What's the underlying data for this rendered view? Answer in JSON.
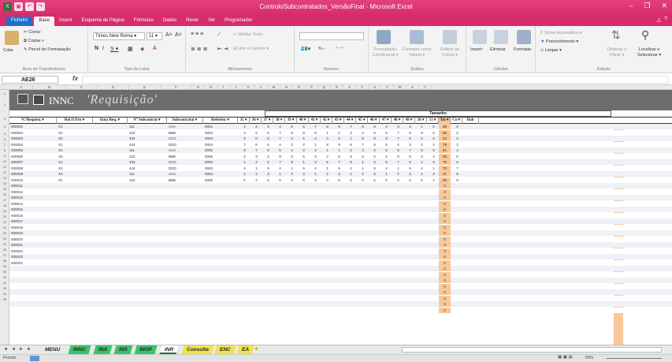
{
  "window": {
    "title": "ControloSubcontratados_VersãoFinal - Microsoft Excel",
    "quick_access": [
      "save-icon",
      "undo-icon",
      "redo-icon"
    ],
    "controls": [
      "–",
      "❐",
      "✕"
    ]
  },
  "ribbon_tabs": [
    "Ficheiro",
    "Base",
    "Inserir",
    "Esquema de Página",
    "Fórmulas",
    "Dados",
    "Rever",
    "Ver",
    "Programador"
  ],
  "ribbon": {
    "clipboard": {
      "cut": "Cortar",
      "copy": "Copiar ▾",
      "paste": "Colar",
      "format_painter": "Pincel de Formatação",
      "label": "Área de Transferência"
    },
    "font": {
      "name": "Times New Roma ▾",
      "size": "11 ▾",
      "grow": "A˄",
      "shrink": "A˅",
      "bold": "N",
      "italic": "I",
      "underline": "S ▾",
      "label": "Tipo de Letra"
    },
    "alignment": {
      "wrap": "Moldar Texto",
      "merge": "Unir e Centrar ▾",
      "label": "Alinhamento"
    },
    "number": {
      "format": "",
      "percent": "% ›",
      "label": "Número"
    },
    "styles": {
      "conditional": "Formatação Condicional ▾",
      "as_table": "Formatar como Tabela ▾",
      "cell_styles": "Estilos de Célula ▾",
      "label": "Estilos"
    },
    "cells": {
      "insert": "Inserir",
      "delete": "Eliminar",
      "format": "Formatar",
      "label": "Células"
    },
    "editing": {
      "autosum": "Soma Automática ▾",
      "fill": "Preenchimento ▾",
      "clear": "Limpar ▾",
      "sort": "Ordenar e Filtrar ▾",
      "find": "Localizar e Selecionar ▾",
      "label": "Edição"
    }
  },
  "formula_bar": {
    "name_box": "AE26",
    "fx": "fx",
    "content": ""
  },
  "sheet": {
    "columns": [
      "A",
      "B",
      "C",
      "D",
      "E",
      "F",
      "G",
      "H",
      "I",
      "J",
      "K",
      "L",
      "M",
      "N",
      "O",
      "P",
      "Q",
      "R",
      "S",
      "T",
      "U",
      "V",
      "W",
      "X",
      "Y"
    ],
    "row_numbers": [
      "1",
      "2",
      "3",
      "4",
      "5",
      "6",
      "7",
      "8",
      "9",
      "10",
      "11",
      "12",
      "13",
      "14",
      "15",
      "16",
      "17",
      "18",
      "19",
      "20",
      "21",
      "22",
      "23",
      "24",
      "25",
      "26",
      "27",
      "28",
      "29",
      "30",
      "31",
      "32",
      "33",
      "34",
      "35"
    ],
    "banner_company": "INNC",
    "banner_subtitle": "'Requisição'",
    "size_group_header": "Tamanho",
    "headers": [
      "N.ºRequisiç ▾",
      "Ref.O.Pro ▾",
      "Data Req. ▾",
      "Nº Subcontrat ▾",
      "Subcontratai ▾",
      "Referênc ▾",
      "35 ▾",
      "36 ▾",
      "37 ▾",
      "38 ▾",
      "39 ▾",
      "40 ▾",
      "41 ▾",
      "42 ▾",
      "43 ▾",
      "44 ▾",
      "45 ▾",
      "46 ▾",
      "47 ▾",
      "48 ▾",
      "49 ▾",
      "50 ▾",
      "51 ▾",
      "Tot ▾",
      "Co ▾",
      "Hab"
    ],
    "rows": [
      [
        "000001",
        "X1",
        "",
        "111",
        "AAA",
        "0001",
        "1",
        "2",
        "3",
        "4",
        "5",
        "6",
        "7",
        "8",
        "9",
        "7",
        "6",
        "5",
        "4",
        "3",
        "2",
        "1",
        "0",
        "88",
        "0"
      ],
      [
        "000002",
        "X2",
        "",
        "222",
        "BBB",
        "0002",
        "4",
        "5",
        "6",
        "7",
        "8",
        "9",
        "8",
        "1",
        "2",
        "3",
        "4",
        "5",
        "6",
        "7",
        "8",
        "9",
        "0",
        "96",
        "2"
      ],
      [
        "000003",
        "X3",
        "",
        "333",
        "CCC",
        "0003",
        "9",
        "8",
        "8",
        "7",
        "6",
        "5",
        "4",
        "3",
        "2",
        "1",
        "8",
        "9",
        "8",
        "7",
        "6",
        "5",
        "4",
        "94",
        "2"
      ],
      [
        "000004",
        "X1",
        "",
        "444",
        "DDD",
        "0004",
        "7",
        "6",
        "5",
        "4",
        "3",
        "2",
        "1",
        "8",
        "9",
        "8",
        "7",
        "6",
        "5",
        "4",
        "3",
        "2",
        "2",
        "79",
        "3"
      ],
      [
        "000005",
        "X2",
        "",
        "111",
        "AAA",
        "0005",
        "8",
        "7",
        "6",
        "5",
        "4",
        "3",
        "2",
        "1",
        "1",
        "2",
        "3",
        "4",
        "5",
        "6",
        "7",
        "8",
        "9",
        "81",
        "4"
      ],
      [
        "000006",
        "X3",
        "",
        "222",
        "BBB",
        "0006",
        "4",
        "3",
        "2",
        "9",
        "6",
        "5",
        "4",
        "2",
        "9",
        "8",
        "5",
        "4",
        "2",
        "9",
        "8",
        "4",
        "4",
        "86",
        "5"
      ],
      [
        "000007",
        "X1",
        "",
        "333",
        "CCC",
        "0002",
        "1",
        "3",
        "5",
        "7",
        "9",
        "1",
        "3",
        "5",
        "7",
        "9",
        "1",
        "3",
        "5",
        "7",
        "9",
        "1",
        "3",
        "79",
        "6"
      ],
      [
        "000008",
        "X2",
        "",
        "444",
        "DDD",
        "0003",
        "4",
        "1",
        "9",
        "4",
        "1",
        "9",
        "4",
        "1",
        "9",
        "4",
        "1",
        "9",
        "4",
        "1",
        "9",
        "4",
        "1",
        "70",
        "7"
      ],
      [
        "000009",
        "X3",
        "",
        "111",
        "AAA",
        "0004",
        "1",
        "2",
        "3",
        "1",
        "2",
        "3",
        "1",
        "2",
        "3",
        "1",
        "2",
        "3",
        "1",
        "2",
        "3",
        "1",
        "2",
        "37",
        "8"
      ],
      [
        "000010",
        "X1",
        "",
        "222",
        "BBB",
        "0005",
        "5",
        "4",
        "6",
        "5",
        "4",
        "6",
        "5",
        "4",
        "6",
        "5",
        "4",
        "6",
        "5",
        "4",
        "6",
        "5",
        "4",
        "96",
        "9"
      ],
      [
        "000011",
        "",
        "",
        "",
        "",
        "",
        "",
        "",
        "",
        "",
        "",
        "",
        "",
        "",
        "",
        "",
        "",
        "",
        "",
        "",
        "",
        "",
        "",
        "0",
        ""
      ],
      [
        "000012",
        "",
        "",
        "",
        "",
        "",
        "",
        "",
        "",
        "",
        "",
        "",
        "",
        "",
        "",
        "",
        "",
        "",
        "",
        "",
        "",
        "",
        "",
        "0",
        ""
      ],
      [
        "000013",
        "",
        "",
        "",
        "",
        "",
        "",
        "",
        "",
        "",
        "",
        "",
        "",
        "",
        "",
        "",
        "",
        "",
        "",
        "",
        "",
        "",
        "",
        "0",
        ""
      ],
      [
        "000014",
        "",
        "",
        "",
        "",
        "",
        "",
        "",
        "",
        "",
        "",
        "",
        "",
        "",
        "",
        "",
        "",
        "",
        "",
        "",
        "",
        "",
        "",
        "0",
        ""
      ],
      [
        "000015",
        "",
        "",
        "",
        "",
        "",
        "",
        "",
        "",
        "",
        "",
        "",
        "",
        "",
        "",
        "",
        "",
        "",
        "",
        "",
        "",
        "",
        "",
        "0",
        ""
      ],
      [
        "000016",
        "",
        "",
        "",
        "",
        "",
        "",
        "",
        "",
        "",
        "",
        "",
        "",
        "",
        "",
        "",
        "",
        "",
        "",
        "",
        "",
        "",
        "",
        "0",
        ""
      ],
      [
        "000017",
        "",
        "",
        "",
        "",
        "",
        "",
        "",
        "",
        "",
        "",
        "",
        "",
        "",
        "",
        "",
        "",
        "",
        "",
        "",
        "",
        "",
        "",
        "0",
        ""
      ],
      [
        "000018",
        "",
        "",
        "",
        "",
        "",
        "",
        "",
        "",
        "",
        "",
        "",
        "",
        "",
        "",
        "",
        "",
        "",
        "",
        "",
        "",
        "",
        "",
        "0",
        ""
      ],
      [
        "000019",
        "",
        "",
        "",
        "",
        "",
        "",
        "",
        "",
        "",
        "",
        "",
        "",
        "",
        "",
        "",
        "",
        "",
        "",
        "",
        "",
        "",
        "",
        "0",
        ""
      ],
      [
        "000020",
        "",
        "",
        "",
        "",
        "",
        "",
        "",
        "",
        "",
        "",
        "",
        "",
        "",
        "",
        "",
        "",
        "",
        "",
        "",
        "",
        "",
        "",
        "0",
        ""
      ],
      [
        "000021",
        "",
        "",
        "",
        "",
        "",
        "",
        "",
        "",
        "",
        "",
        "",
        "",
        "",
        "",
        "",
        "",
        "",
        "",
        "",
        "",
        "",
        "",
        "0",
        ""
      ],
      [
        "000022",
        "",
        "",
        "",
        "",
        "",
        "",
        "",
        "",
        "",
        "",
        "",
        "",
        "",
        "",
        "",
        "",
        "",
        "",
        "",
        "",
        "",
        "",
        "0",
        ""
      ],
      [
        "000023",
        "",
        "",
        "",
        "",
        "",
        "",
        "",
        "",
        "",
        "",
        "",
        "",
        "",
        "",
        "",
        "",
        "",
        "",
        "",
        "",
        "",
        "",
        "0",
        ""
      ],
      [
        "000001",
        "",
        "",
        "",
        "",
        "",
        "",
        "",
        "",
        "",
        "",
        "",
        "",
        "",
        "",
        "",
        "",
        "",
        "",
        "",
        "",
        "",
        "",
        "0",
        ""
      ],
      [
        "",
        "",
        "",
        "",
        "",
        "",
        "",
        "",
        "",
        "",
        "",
        "",
        "",
        "",
        "",
        "",
        "",
        "",
        "",
        "",
        "",
        "",
        "",
        "0",
        ""
      ],
      [
        "",
        "",
        "",
        "",
        "",
        "",
        "",
        "",
        "",
        "",
        "",
        "",
        "",
        "",
        "",
        "",
        "",
        "",
        "",
        "",
        "",
        "",
        "",
        "0",
        ""
      ],
      [
        "",
        "",
        "",
        "",
        "",
        "",
        "",
        "",
        "",
        "",
        "",
        "",
        "",
        "",
        "",
        "",
        "",
        "",
        "",
        "",
        "",
        "",
        "",
        "0",
        ""
      ],
      [
        "",
        "",
        "",
        "",
        "",
        "",
        "",
        "",
        "",
        "",
        "",
        "",
        "",
        "",
        "",
        "",
        "",
        "",
        "",
        "",
        "",
        "",
        "",
        "0",
        ""
      ],
      [
        "",
        "",
        "",
        "",
        "",
        "",
        "",
        "",
        "",
        "",
        "",
        "",
        "",
        "",
        "",
        "",
        "",
        "",
        "",
        "",
        "",
        "",
        "",
        "0",
        ""
      ],
      [
        "",
        "",
        "",
        "",
        "",
        "",
        "",
        "",
        "",
        "",
        "",
        "",
        "",
        "",
        "",
        "",
        "",
        "",
        "",
        "",
        "",
        "",
        "",
        "0",
        ""
      ],
      [
        "",
        "",
        "",
        "",
        "",
        "",
        "",
        "",
        "",
        "",
        "",
        "",
        "",
        "",
        "",
        "",
        "",
        "",
        "",
        "",
        "",
        "",
        "",
        "0",
        ""
      ],
      [
        "",
        "",
        "",
        "",
        "",
        "",
        "",
        "",
        "",
        "",
        "",
        "",
        "",
        "",
        "",
        "",
        "",
        "",
        "",
        "",
        "",
        "",
        "",
        "0",
        ""
      ]
    ]
  },
  "sheet_tabs": {
    "nav": [
      "◄",
      "◄",
      "►",
      "►"
    ],
    "tabs": [
      {
        "label": "MENU",
        "color": "#e9e9e9"
      },
      {
        "label": "INNC",
        "color": "#3cc36a"
      },
      {
        "label": "INA",
        "color": "#3cc36a"
      },
      {
        "label": "INS",
        "color": "#3cc36a"
      },
      {
        "label": "INOP",
        "color": "#3cc36a"
      },
      {
        "label": "INR",
        "color": "#ffffff"
      },
      {
        "label": "Consulta",
        "color": "#f0e34a"
      },
      {
        "label": "ENC",
        "color": "#f0e34a"
      },
      {
        "label": "EA",
        "color": "#f0e34a"
      }
    ]
  },
  "status_bar": {
    "mode": "Pronto",
    "zoom": "70%"
  },
  "colors": {
    "accent": "#d72c6b",
    "file_tab": "#1f6fcf",
    "banner": "#6d6d6d",
    "total_col": "#f7c89a"
  }
}
